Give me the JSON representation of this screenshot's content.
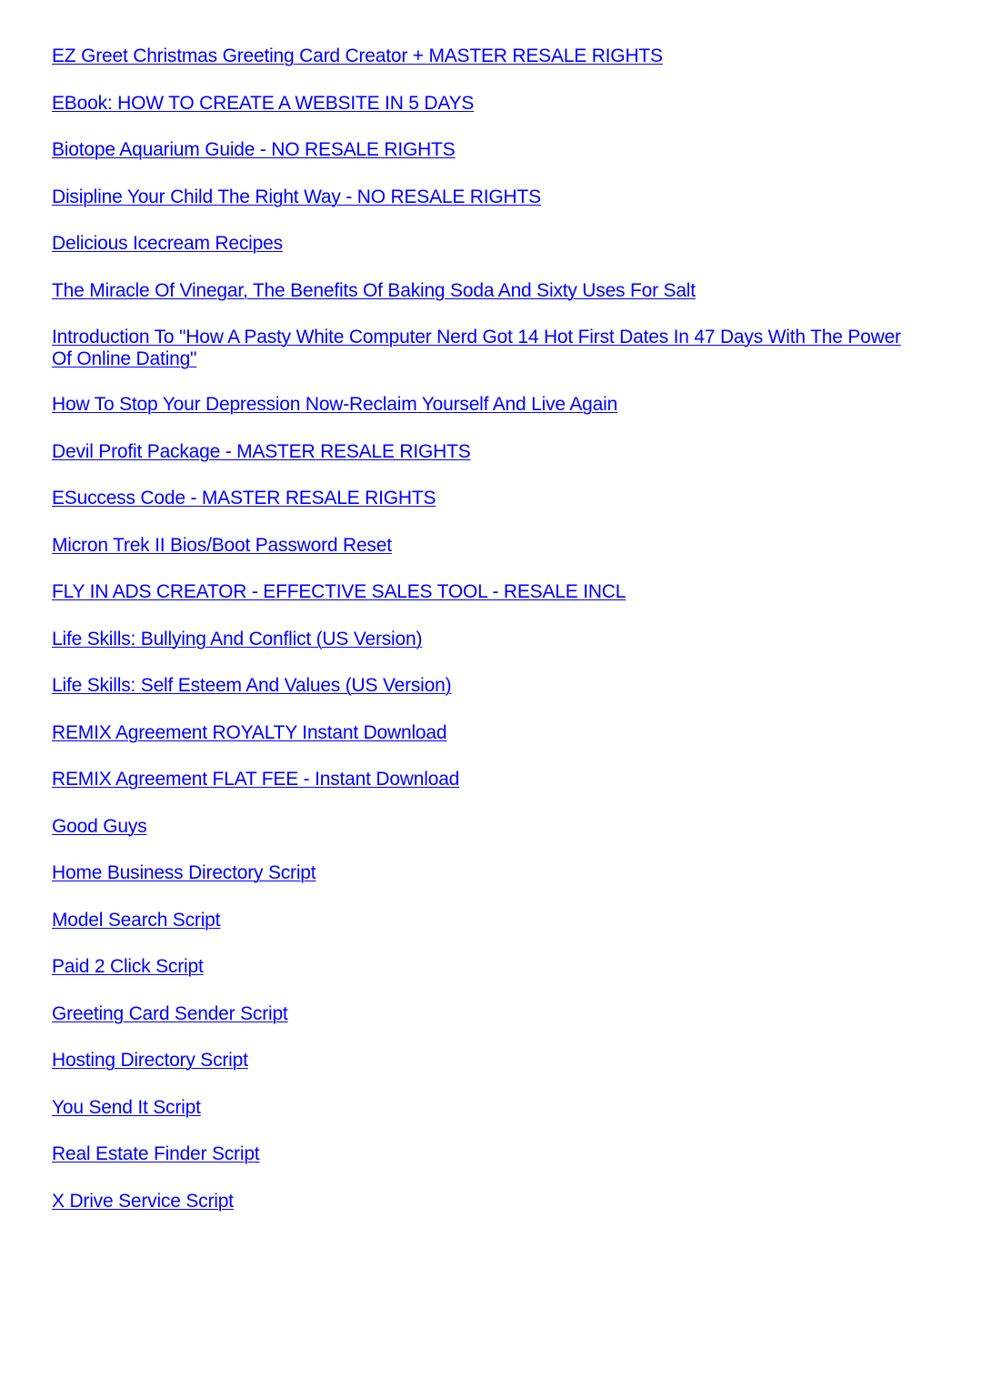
{
  "links": [
    {
      "label": "EZ Greet Christmas Greeting Card Creator + MASTER RESALE RIGHTS"
    },
    {
      "label": "EBook: HOW TO CREATE A WEBSITE IN 5 DAYS"
    },
    {
      "label": "Biotope Aquarium Guide - NO RESALE RIGHTS"
    },
    {
      "label": "Disipline Your Child The Right Way - NO RESALE RIGHTS"
    },
    {
      "label": "Delicious Icecream Recipes"
    },
    {
      "label": "The Miracle Of Vinegar, The Benefits Of Baking Soda And Sixty Uses For Salt"
    },
    {
      "label": "Introduction To \"How A Pasty White Computer Nerd Got 14 Hot First Dates In 47 Days With The Power Of Online Dating\""
    },
    {
      "label": "How To Stop Your Depression Now-Reclaim Yourself And Live Again"
    },
    {
      "label": "Devil Profit Package - MASTER RESALE RIGHTS"
    },
    {
      "label": "ESuccess Code - MASTER RESALE RIGHTS"
    },
    {
      "label": "Micron Trek II Bios/Boot Password Reset"
    },
    {
      "label": "FLY IN ADS CREATOR - EFFECTIVE SALES TOOL - RESALE INCL"
    },
    {
      "label": "Life Skills: Bullying And Conflict (US Version)"
    },
    {
      "label": "Life Skills: Self Esteem And Values (US Version)"
    },
    {
      "label": "REMIX Agreement ROYALTY Instant Download"
    },
    {
      "label": "REMIX Agreement FLAT FEE - Instant Download"
    },
    {
      "label": "Good Guys"
    },
    {
      "label": "Home Business Directory Script"
    },
    {
      "label": "Model Search Script"
    },
    {
      "label": "Paid 2 Click Script"
    },
    {
      "label": "Greeting Card Sender Script"
    },
    {
      "label": "Hosting Directory Script"
    },
    {
      "label": "You Send It Script"
    },
    {
      "label": "Real Estate Finder Script"
    },
    {
      "label": "X Drive Service Script"
    }
  ],
  "colors": {
    "link": "#0000ff",
    "background": "#ffffff"
  }
}
